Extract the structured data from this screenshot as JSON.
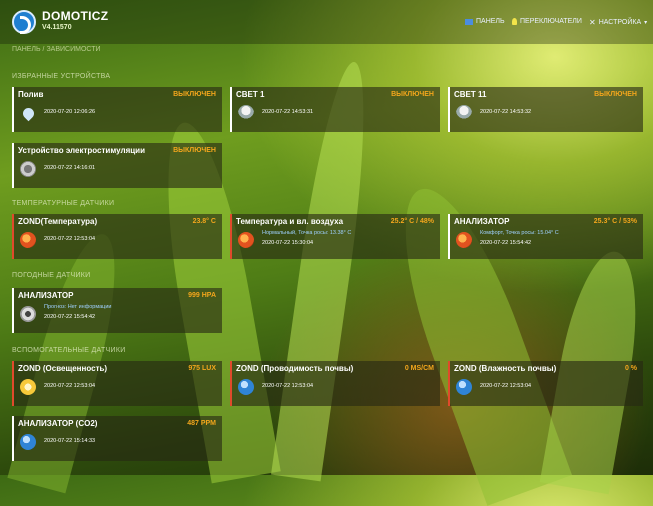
{
  "header": {
    "brand": "DOMOTICZ",
    "version": "V4.11570",
    "nav": [
      {
        "label": "ПАНЕЛЬ",
        "icon": "panel-icon"
      },
      {
        "label": "ПЕРЕКЛЮЧАТЕЛИ",
        "icon": "lightbulb-icon"
      },
      {
        "label": "НАСТРОЙКА",
        "icon": "wrench-icon"
      }
    ]
  },
  "breadcrumb": "ПАНЕЛЬ / ЗАВИСИМОСТИ",
  "sections": {
    "switches": "ИЗБРАННЫЕ УСТРОЙСТВА",
    "temperature": "ТЕМПЕРАТУРНЫЕ ДАТЧИКИ",
    "weather": "ПОГОДНЫЕ ДАТЧИКИ",
    "utility": "ВСПОМОГАТЕЛЬНЫЕ ДАТЧИКИ"
  },
  "cards": {
    "poliv": {
      "name": "Полив",
      "status": "ВЫКЛЮЧЕН",
      "date": "2020-07-20 12:06:26"
    },
    "svet1": {
      "name": "СВЕТ 1",
      "status": "ВЫКЛЮЧЕН",
      "date": "2020-07-22 14:53:31"
    },
    "svet11": {
      "name": "СВЕТ 11",
      "status": "ВЫКЛЮЧЕН",
      "date": "2020-07-22 14:53:32"
    },
    "device": {
      "name": "Устройство электростимуляции",
      "status": "ВЫКЛЮЧЕН",
      "date": "2020-07-22 14:16:01"
    },
    "zond_temp": {
      "name": "ZOND(Температура)",
      "status": "23.8° C",
      "date": "2020-07-22 12:53:04"
    },
    "temp_hum": {
      "name": "Температура и вл. воздуха",
      "status": "25.2° C / 48%",
      "extra": "Нормальный, Точка росы: 13.38° C",
      "date": "2020-07-22 15:30:04"
    },
    "analyzer1": {
      "name": "АНАЛИЗАТОР",
      "status": "25.3° C / 53%",
      "extra": "Комфорт, Точка росы: 15.04° C",
      "date": "2020-07-22 15:54:42"
    },
    "analyzer2": {
      "name": "АНАЛИЗАТОР",
      "status": "999 HPA",
      "extra": "Прогноз: Нет информации",
      "date": "2020-07-22 15:54:42"
    },
    "zond_light": {
      "name": "ZOND (Освещенность)",
      "status": "975 LUX",
      "date": "2020-07-22 12:53:04"
    },
    "zond_cond": {
      "name": "ZOND (Проводимость почвы)",
      "status": "0 MS/CM",
      "date": "2020-07-22 12:53:04"
    },
    "zond_hum": {
      "name": "ZOND (Влажность почвы)",
      "status": "0 %",
      "date": "2020-07-22 12:53:04"
    },
    "analyzer_co2": {
      "name": "АНАЛИЗАТОР (CO2)",
      "status": "487 PPM",
      "date": "2020-07-22 15:14:33"
    }
  },
  "colors": {
    "status": "#f3a61c",
    "accent": "#1f7fd0",
    "alert_border": "#e04a2b"
  }
}
